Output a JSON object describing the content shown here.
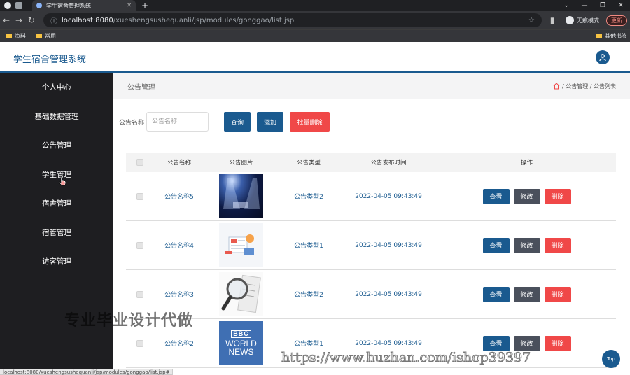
{
  "browser": {
    "tab_title": "学生宿舍管理系统",
    "url_host": "localhost:8080",
    "url_path": "/xueshengsushequanli/jsp/modules/gonggao/list.jsp",
    "incognito_label": "无痕模式",
    "update_label": "更新",
    "bookmarks": [
      "资料",
      "常用"
    ],
    "other_bookmarks": "其他书签",
    "status_url": "localhost:8080/xueshengsushequanli/jsp/modules/gonggao/list.jsp#"
  },
  "app": {
    "title": "学生宿舍管理系统",
    "accent": "#1a5a8f"
  },
  "sidebar": {
    "items": [
      {
        "label": "个人中心"
      },
      {
        "label": "基础数据管理"
      },
      {
        "label": "公告管理"
      },
      {
        "label": "学生管理"
      },
      {
        "label": "宿舍管理"
      },
      {
        "label": "宿管管理"
      },
      {
        "label": "访客管理"
      }
    ]
  },
  "breadcrumb": {
    "title": "公告管理",
    "path": "/ 公告管理 / 公告列表"
  },
  "search": {
    "label": "公告名称",
    "placeholder": "公告名称",
    "query_label": "查询",
    "add_label": "添加",
    "batch_delete_label": "批量删除"
  },
  "table": {
    "headers": [
      "公告名称",
      "公告图片",
      "公告类型",
      "公告发布时间",
      "操作"
    ],
    "view_label": "查看",
    "edit_label": "修改",
    "delete_label": "删除",
    "rows": [
      {
        "name": "公告名称5",
        "type": "公告类型2",
        "time": "2022-04-05 09:43:49",
        "image": "stage-spotlight"
      },
      {
        "name": "公告名称4",
        "type": "公告类型1",
        "time": "2022-04-05 09:43:49",
        "image": "news-illustration"
      },
      {
        "name": "公告名称3",
        "type": "公告类型2",
        "time": "2022-04-05 09:43:49",
        "image": "magnifier-news"
      },
      {
        "name": "公告名称2",
        "type": "公告类型1",
        "time": "2022-04-05 09:43:49",
        "image": "bbc-world-news",
        "image_text": [
          "BBC",
          "WORLD",
          "NEWS"
        ]
      }
    ]
  },
  "overlay": {
    "watermark_text": "专业毕业设计代做",
    "watermark_url": "https://www.huzhan.com/ishop39397"
  },
  "top_button_label": "Top"
}
